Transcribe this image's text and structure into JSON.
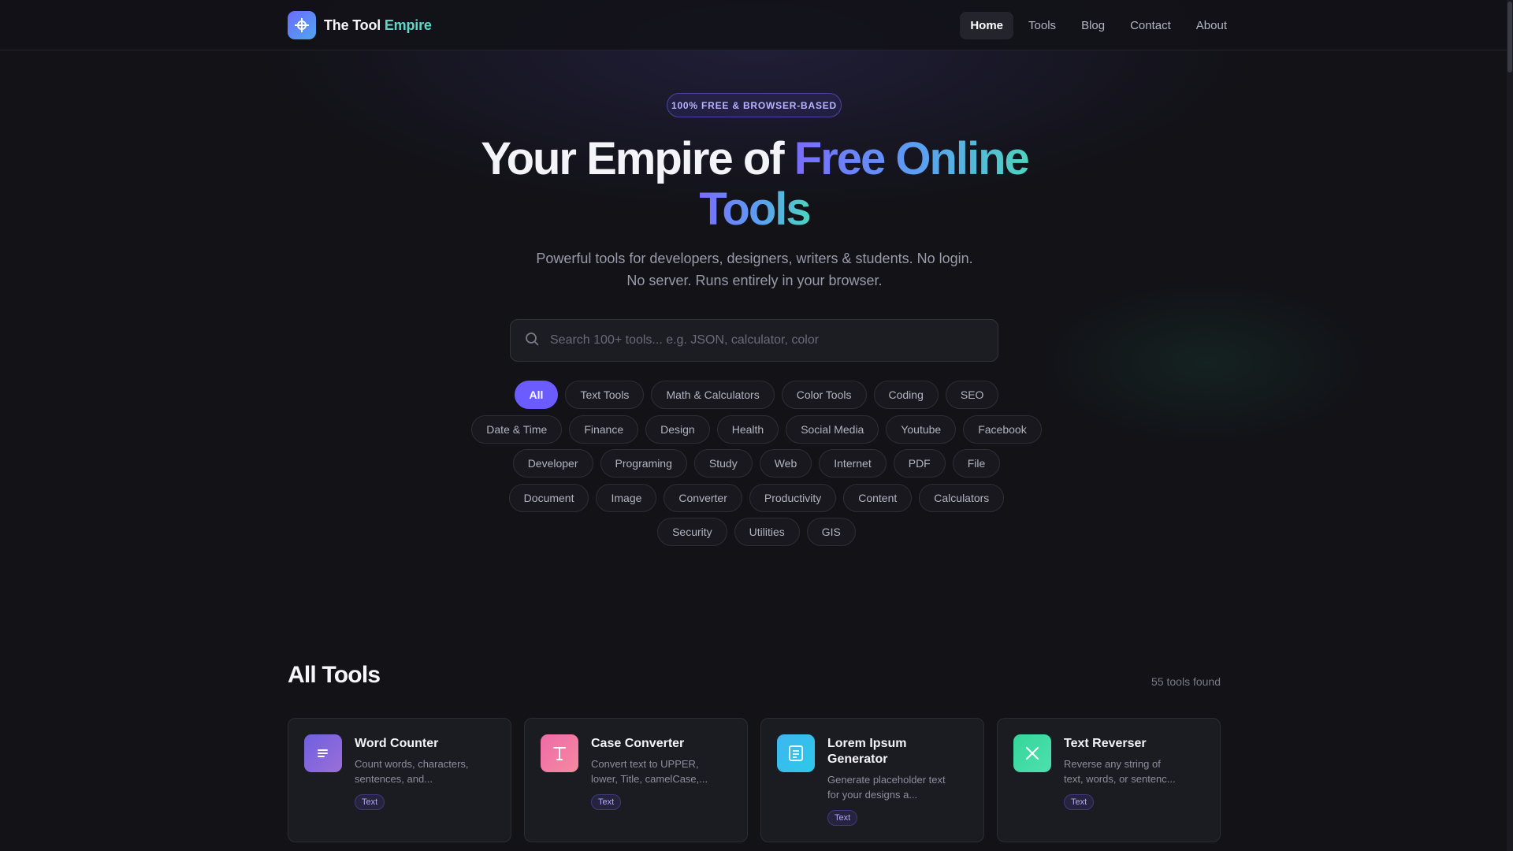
{
  "header": {
    "logo_main": "The Tool ",
    "logo_accent": "Empire",
    "nav": [
      {
        "label": "Home",
        "active": true
      },
      {
        "label": "Tools",
        "active": false
      },
      {
        "label": "Blog",
        "active": false
      },
      {
        "label": "Contact",
        "active": false
      },
      {
        "label": "About",
        "active": false
      }
    ]
  },
  "hero": {
    "badge": "100% FREE & BROWSER-BASED",
    "title_plain": "Your Empire of ",
    "title_gradient_1": "Free Online",
    "title_gradient_2": "Tools",
    "subtitle": "Powerful tools for developers, designers, writers & students. No login. No server. Runs entirely in your browser."
  },
  "search": {
    "placeholder": "Search 100+ tools... e.g. JSON, calculator, color",
    "value": ""
  },
  "categories": {
    "row1": [
      "All",
      "Text Tools",
      "Math & Calculators",
      "Color Tools",
      "Coding",
      "SEO"
    ],
    "row2": [
      "Date & Time",
      "Finance",
      "Design",
      "Health",
      "Social Media",
      "Youtube",
      "Facebook"
    ],
    "row3": [
      "Developer",
      "Programing",
      "Study",
      "Web",
      "Internet",
      "PDF",
      "File"
    ],
    "row4": [
      "Document",
      "Image",
      "Converter",
      "Productivity",
      "Content",
      "Calculators"
    ],
    "row5": [
      "Security",
      "Utilities",
      "GIS"
    ],
    "selected": "All"
  },
  "tools_section": {
    "title": "All Tools",
    "count_label": "55 tools found",
    "cards": [
      {
        "title": "Word Counter",
        "desc": "Count words, characters, sentences, and...",
        "tag": "Text",
        "icon": "lines-icon",
        "color_from": "#6f5fe0",
        "color_to": "#9b6fd8"
      },
      {
        "title": "Case Converter",
        "desc": "Convert text to UPPER, lower, Title, camelCase,...",
        "tag": "Text",
        "icon": "letter-t-icon",
        "color_from": "#f06aa8",
        "color_to": "#f58aa0"
      },
      {
        "title": "Lorem Ipsum Generator",
        "desc": "Generate placeholder text for your designs a...",
        "tag": "Text",
        "icon": "document-icon",
        "color_from": "#3db6f0",
        "color_to": "#2ec8e8"
      },
      {
        "title": "Text Reverser",
        "desc": "Reverse any string of text, words, or sentenc...",
        "tag": "Text",
        "icon": "cross-icon",
        "color_from": "#34d69a",
        "color_to": "#4ee0b0"
      }
    ]
  }
}
